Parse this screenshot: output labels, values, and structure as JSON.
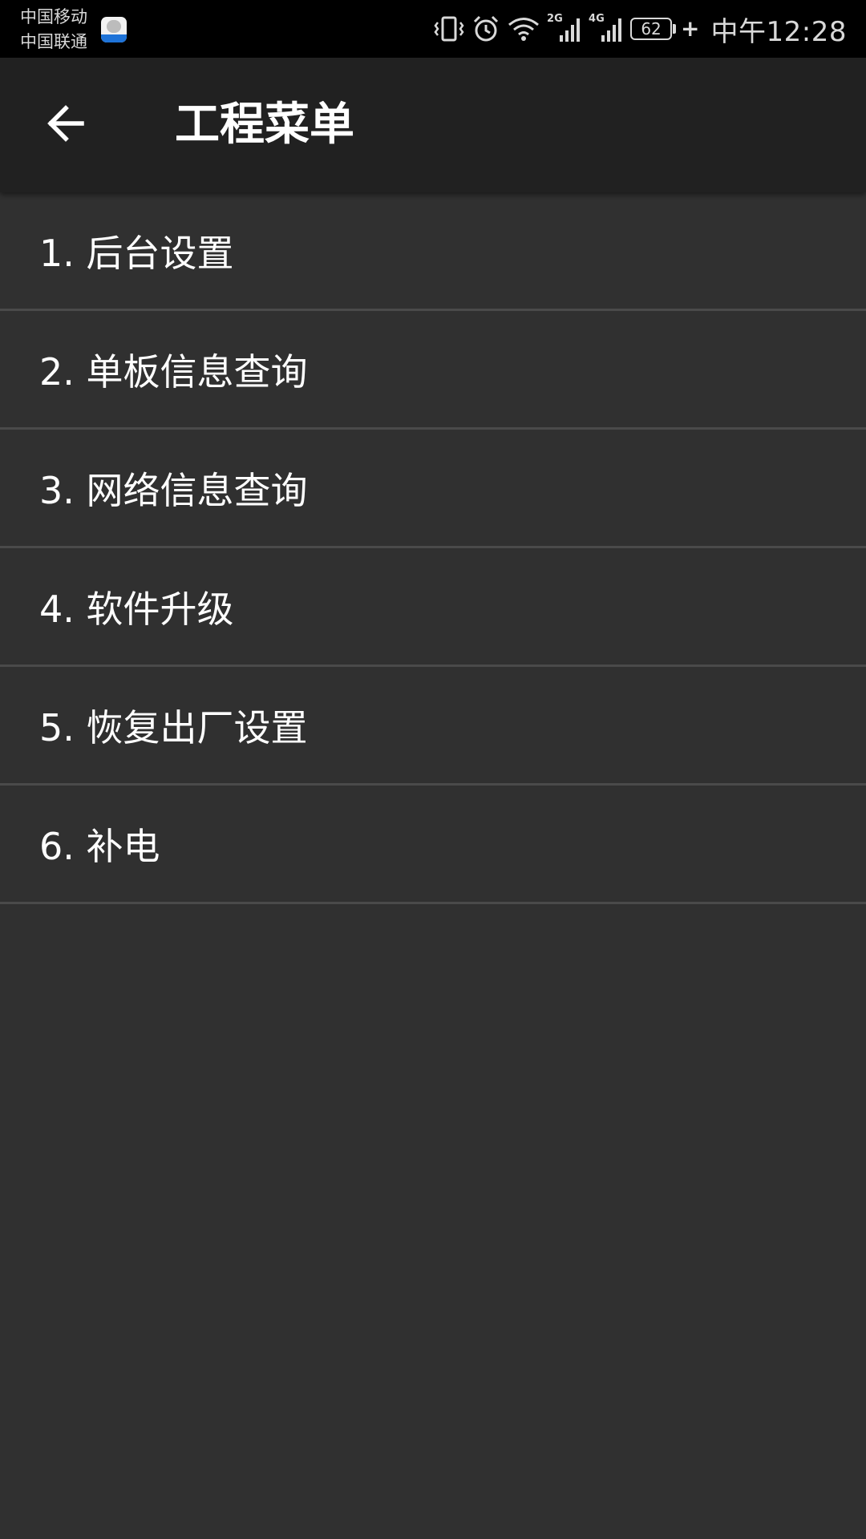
{
  "status_bar": {
    "carrier_1": "中国移动",
    "carrier_2": "中国联通",
    "network_1": "2G",
    "network_2": "4G",
    "battery": "62",
    "time": "中午12:28"
  },
  "header": {
    "title": "工程菜单",
    "back_icon": "arrow-left-icon"
  },
  "menu": {
    "items": [
      {
        "label": "1. 后台设置"
      },
      {
        "label": "2. 单板信息查询"
      },
      {
        "label": "3. 网络信息查询"
      },
      {
        "label": "4. 软件升级"
      },
      {
        "label": "5. 恢复出厂设置"
      },
      {
        "label": "6. 补电"
      }
    ]
  },
  "colors": {
    "status_bar_bg": "#000000",
    "app_bar_bg": "#212121",
    "list_bg": "#303030",
    "divider": "#4a4a4a",
    "text": "#ffffff"
  }
}
